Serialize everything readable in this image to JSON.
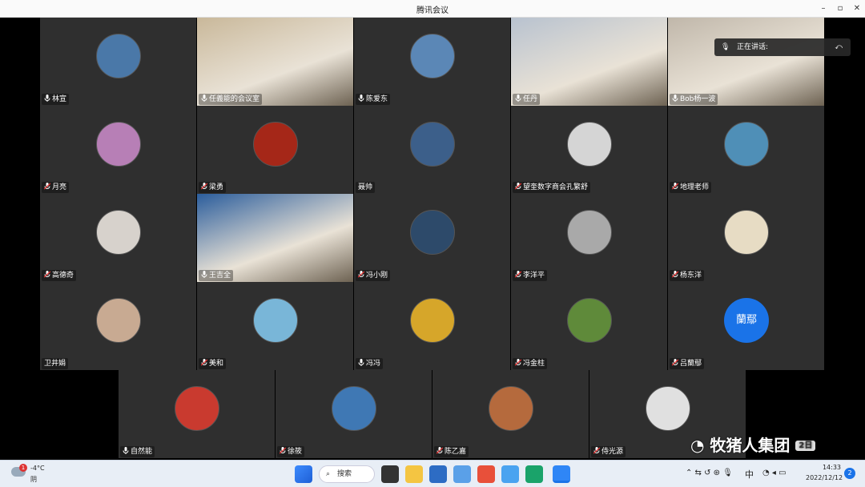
{
  "window": {
    "title": "腾讯会议"
  },
  "speaking": {
    "label": "正在讲话:"
  },
  "participants": [
    {
      "name": "林宣",
      "mic": "on",
      "color": "#4a78a8"
    },
    {
      "name": "任義能的会议室",
      "mic": "on",
      "color": "#c9b89a",
      "video": true
    },
    {
      "name": "陈爱东",
      "mic": "on",
      "color": "#5b87b6"
    },
    {
      "name": "任丹",
      "mic": "on",
      "color": "#b8c2cf",
      "video": true
    },
    {
      "name": "Bob杨一波",
      "mic": "on",
      "color": "#c0b7aa",
      "video": true
    },
    {
      "name": "月亮",
      "mic": "off",
      "color": "#b77fb6"
    },
    {
      "name": "梁勇",
      "mic": "off",
      "color": "#a52718"
    },
    {
      "name": "聂帅",
      "mic": "none",
      "color": "#3c5f8a"
    },
    {
      "name": "望奎数字商会孔繁舒",
      "mic": "off",
      "color": "#d5d5d5"
    },
    {
      "name": "地理老师",
      "mic": "off",
      "color": "#4f8fb7"
    },
    {
      "name": "高德奇",
      "mic": "off",
      "color": "#d7d2cc"
    },
    {
      "name": "王吉全",
      "mic": "on",
      "color": "#2b5d9c",
      "video": true
    },
    {
      "name": "冯小刚",
      "mic": "off",
      "color": "#2d4a6a"
    },
    {
      "name": "李洋平",
      "mic": "off",
      "color": "#a9a9a9"
    },
    {
      "name": "杨东洋",
      "mic": "off",
      "color": "#e7dcc4"
    },
    {
      "name": "卫井娟",
      "mic": "none",
      "color": "#c8aa92"
    },
    {
      "name": "美和",
      "mic": "off",
      "color": "#79b6d8"
    },
    {
      "name": "冯冯",
      "mic": "on",
      "color": "#d6a62a"
    },
    {
      "name": "冯金柱",
      "mic": "off",
      "color": "#5f8a3a"
    },
    {
      "name": "吕蘭鄢",
      "mic": "off",
      "color": "#1a73e8",
      "initials": "蘭鄢"
    },
    {
      "name": "自然能",
      "mic": "on",
      "color": "#c93a2f"
    },
    {
      "name": "徐筱",
      "mic": "off",
      "color": "#3f78b4"
    },
    {
      "name": "陈乙嘉",
      "mic": "off",
      "color": "#b56a3d"
    },
    {
      "name": "侍光源",
      "mic": "off",
      "color": "#e0e0e0"
    }
  ],
  "taskbar": {
    "weather_temp": "-4°C",
    "weather_desc": "阴",
    "search_label": "搜索",
    "ime": "中",
    "time": "14:33",
    "date": "2022/12/12",
    "notifications": "2",
    "weather_badge": "1"
  },
  "watermark": {
    "text": "牧猪人集团",
    "badge": "2日"
  }
}
